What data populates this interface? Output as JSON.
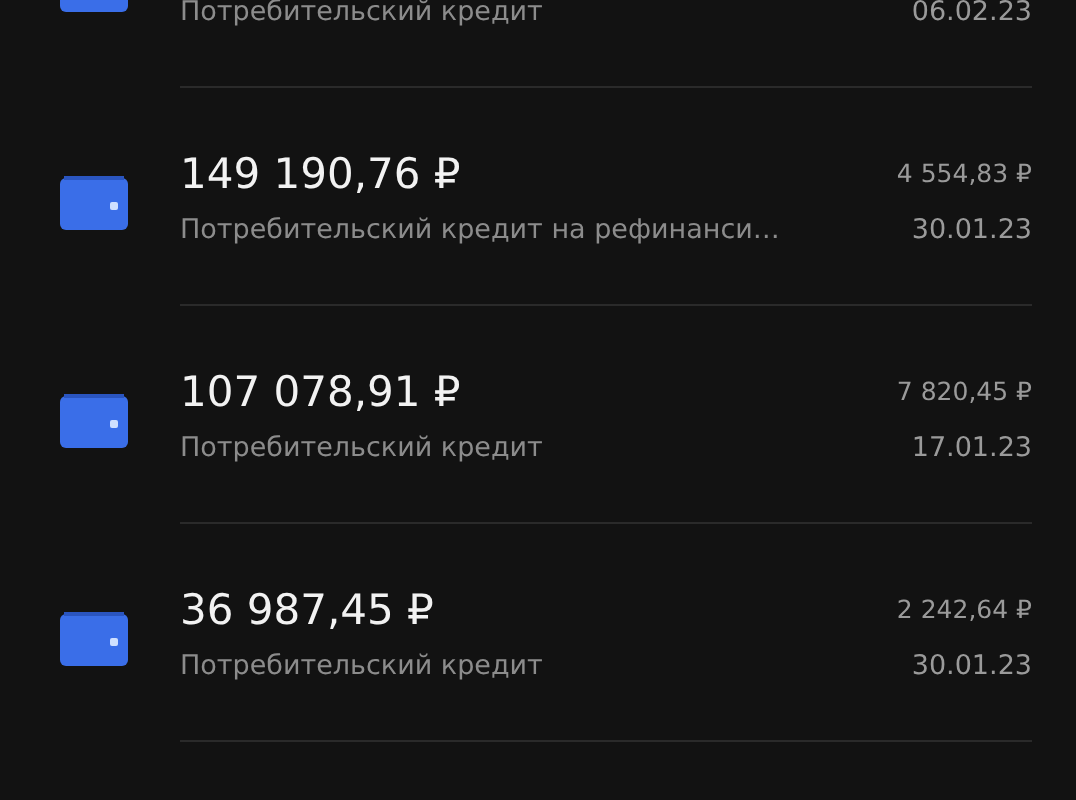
{
  "loans": [
    {
      "description": "Потребительский кредит",
      "date": "06.02.23"
    },
    {
      "amount": "149 190,76 ₽",
      "description": "Потребительский кредит на рефинанси…",
      "payment": "4 554,83 ₽",
      "date": "30.01.23"
    },
    {
      "amount": "107 078,91 ₽",
      "description": "Потребительский кредит",
      "payment": "7 820,45 ₽",
      "date": "17.01.23"
    },
    {
      "amount": "36 987,45 ₽",
      "description": "Потребительский кредит",
      "payment": "2 242,64 ₽",
      "date": "30.01.23"
    }
  ]
}
